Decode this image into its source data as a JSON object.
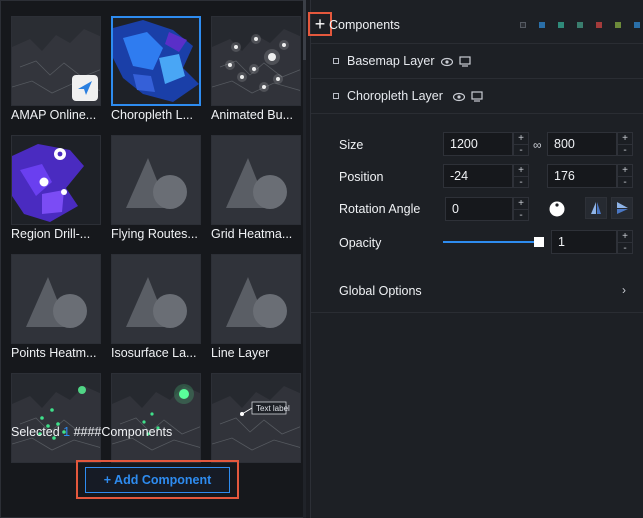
{
  "library": {
    "tiles": [
      {
        "label": "AMAP Online...",
        "thumb": "dark-map-with-amap-logo",
        "selected": false
      },
      {
        "label": "Choropleth L...",
        "thumb": "blue-choropleth-map",
        "selected": true
      },
      {
        "label": "Animated Bu...",
        "thumb": "dark-map-with-bubbles",
        "selected": false
      },
      {
        "label": "Region Drill-...",
        "thumb": "purple-region-map-with-pins",
        "selected": false
      },
      {
        "label": "Flying Routes...",
        "thumb": "placeholder-shapes",
        "selected": false
      },
      {
        "label": "Grid Heatma...",
        "thumb": "placeholder-shapes",
        "selected": false
      },
      {
        "label": "Points Heatm...",
        "thumb": "placeholder-shapes",
        "selected": false
      },
      {
        "label": "Isosurface La...",
        "thumb": "placeholder-shapes",
        "selected": false
      },
      {
        "label": "Line Layer",
        "thumb": "placeholder-shapes",
        "selected": false
      },
      {
        "label": "",
        "thumb": "dark-map-green-points",
        "selected": false
      },
      {
        "label": "",
        "thumb": "dark-map-green-glow",
        "selected": false
      },
      {
        "label": "",
        "thumb": "dark-map-text-label",
        "thumb_text": "Text label",
        "selected": false
      }
    ],
    "selected_prefix": "Selected",
    "selected_count": "1",
    "selected_suffix": "####Components",
    "add_button": "+ Add Component"
  },
  "panel": {
    "plus": "+",
    "title": "Components",
    "colors": [
      "#2b2e34",
      "#2a6fa8",
      "#2f8a7a",
      "#3a7d6e",
      "#a33b3b",
      "#6c8a3a",
      "#2a6fa8"
    ],
    "layers": [
      {
        "name": "Basemap Layer"
      },
      {
        "name": "Choropleth Layer"
      }
    ],
    "size": {
      "label": "Size",
      "width": "1200",
      "height": "800"
    },
    "position": {
      "label": "Position",
      "x": "-24",
      "y": "176"
    },
    "rotation": {
      "label": "Rotation Angle",
      "value": "0"
    },
    "opacity": {
      "label": "Opacity",
      "value": "1",
      "level": 1.0
    },
    "global_options": "Global Options",
    "stepper_up": "+",
    "stepper_down": "-"
  }
}
